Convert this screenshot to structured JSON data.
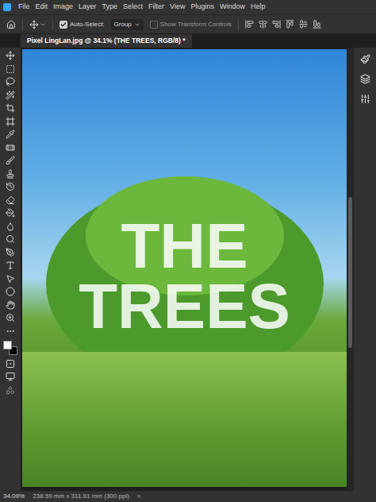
{
  "menu_bar": {
    "items": [
      "File",
      "Edit",
      "Image",
      "Layer",
      "Type",
      "Select",
      "Filter",
      "View",
      "Plugins",
      "Window",
      "Help"
    ]
  },
  "options_bar": {
    "auto_select": {
      "label": "Auto-Select:",
      "checked": true
    },
    "auto_select_target": "Group",
    "transform_controls": {
      "label": "Show Transform Controls",
      "checked": false
    }
  },
  "document_tab": {
    "title": "Pixel LingLan.jpg @ 34.1% (THE TREES, RGB/8) *"
  },
  "canvas": {
    "text_layer": "THE TREES"
  },
  "status_bar": {
    "zoom": "34.09%",
    "doc_size": "238.59 mm x 311.91 mm (300 ppi)",
    "arrow": ">"
  }
}
